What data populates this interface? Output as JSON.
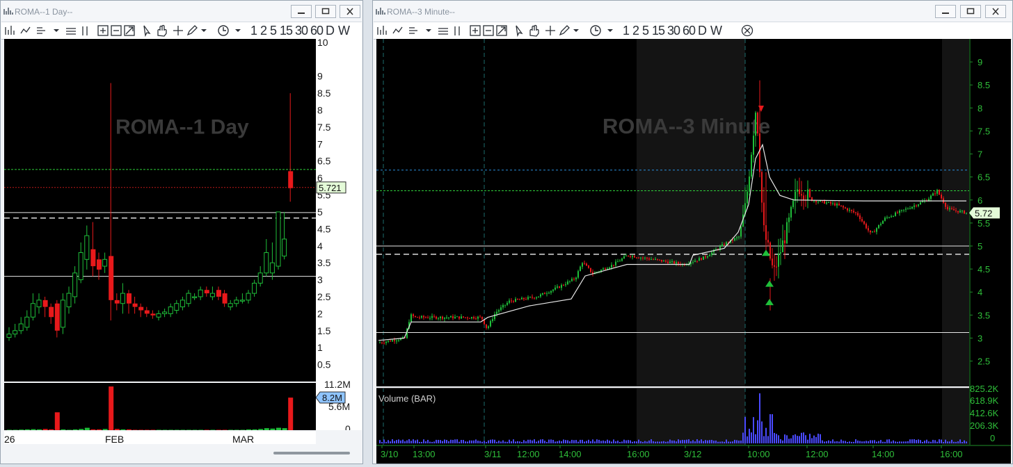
{
  "left": {
    "title": "ROMA--1 Day--",
    "watermark": "ROMA--1 Day",
    "last_price_tag": "5.721",
    "volume_tag": "8.2M",
    "y_ticks": [
      "10",
      "9",
      "8.5",
      "8",
      "7.5",
      "7",
      "6.5",
      "6",
      "5.5",
      "5",
      "4.5",
      "4",
      "3.5",
      "3",
      "2.5",
      "2",
      "1.5",
      "1",
      "0.5"
    ],
    "volume_ticks": [
      "11.2M",
      "5.6M",
      "0"
    ],
    "x_ticks": [
      "26",
      "FEB",
      "MAR"
    ],
    "timeframes": [
      "1",
      "2",
      "5",
      "15",
      "30",
      "60",
      "D",
      "W"
    ]
  },
  "right": {
    "title": "ROMA--3 Minute--",
    "watermark": "ROMA--3 Minute",
    "last_price_tag": "5.72",
    "volume_label": "Volume (BAR)",
    "y_ticks": [
      "9",
      "8.5",
      "8",
      "7.5",
      "7",
      "6.5",
      "6",
      "5.5",
      "5",
      "4.5",
      "4",
      "3.5",
      "3",
      "2.5"
    ],
    "volume_ticks": [
      "825.2K",
      "618.9K",
      "412.6K",
      "206.3K",
      "0"
    ],
    "x_ticks": [
      "3/10",
      "13:00",
      "3/11",
      "12:00",
      "14:00",
      "16:00",
      "3/12",
      "10:00",
      "12:00",
      "14:00",
      "16:00"
    ],
    "timeframes": [
      "1",
      "2",
      "5",
      "15",
      "30",
      "60",
      "D",
      "W"
    ]
  },
  "colors": {
    "up": "#1fbf3a",
    "down": "#e8191b",
    "axis_text": "#2fbf3a",
    "vwap": "#e9e9e9",
    "volume_right": "#4a4aff"
  }
}
